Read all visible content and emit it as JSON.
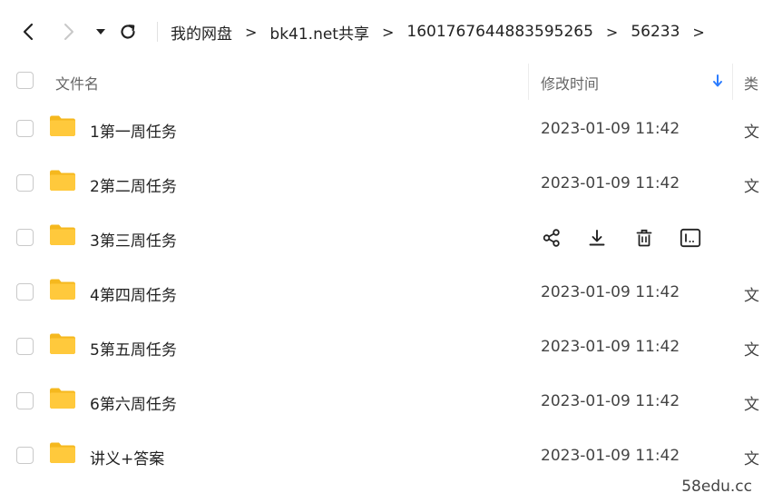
{
  "toolbar": {
    "back_icon": "chevron-left-icon",
    "forward_icon": "chevron-right-icon",
    "history_icon": "caret-down-icon",
    "refresh_icon": "refresh-icon"
  },
  "breadcrumb": {
    "items": [
      {
        "label": "我的网盘"
      },
      {
        "label": "bk41.net共享"
      },
      {
        "label": "1601767644883595265"
      },
      {
        "label": "56233"
      }
    ],
    "separator": ">"
  },
  "table": {
    "headers": {
      "name": "文件名",
      "modified": "修改时间",
      "type": "类"
    },
    "sort_icon": "arrow-down-icon",
    "rows": [
      {
        "name": "1第一周任务",
        "date": "2023-01-09 11:42",
        "type": "文"
      },
      {
        "name": "2第二周任务",
        "date": "2023-01-09 11:42",
        "type": "文"
      },
      {
        "name": "3第三周任务",
        "date": "",
        "type": "",
        "hovered": true
      },
      {
        "name": "4第四周任务",
        "date": "2023-01-09 11:42",
        "type": "文"
      },
      {
        "name": "5第五周任务",
        "date": "2023-01-09 11:42",
        "type": "文"
      },
      {
        "name": "6第六周任务",
        "date": "2023-01-09 11:42",
        "type": "文"
      },
      {
        "name": "讲义+答案",
        "date": "2023-01-09 11:42",
        "type": "文"
      }
    ]
  },
  "row_actions": [
    "share-icon",
    "download-icon",
    "delete-icon",
    "rename-icon"
  ],
  "colors": {
    "folder": "#FFC93C",
    "folder_back": "#F5B81E",
    "sort_arrow": "#2b7cff"
  },
  "watermark": "58edu.cc"
}
